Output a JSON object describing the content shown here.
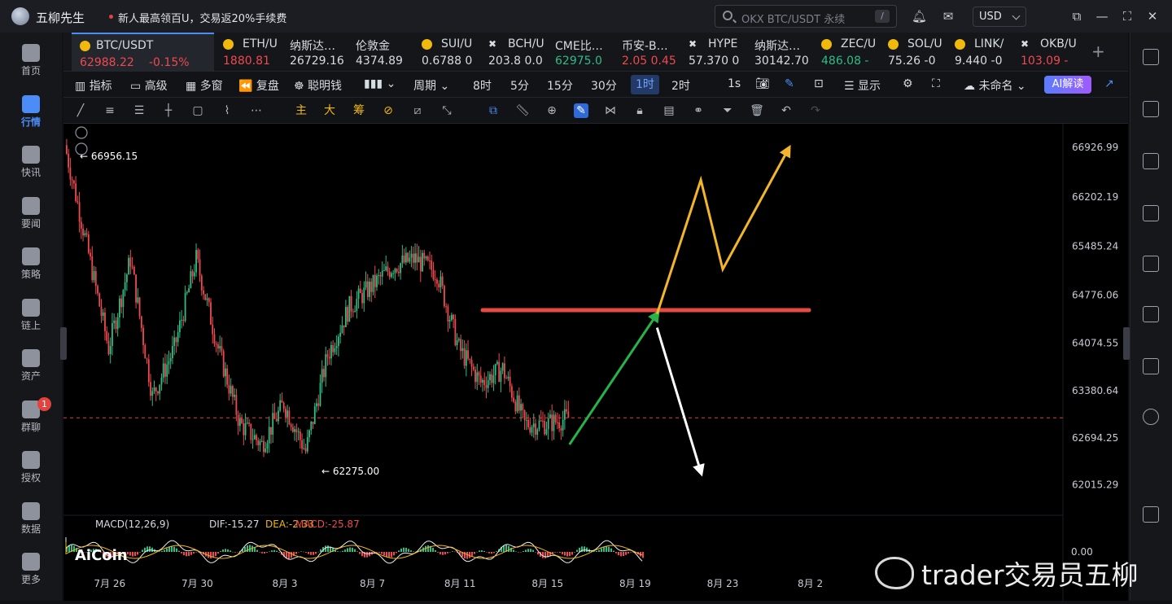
{
  "app": {
    "name": "五柳先生",
    "promo": "新人最高领百U，交易返20%手续费"
  },
  "search": {
    "placeholder": "OKX BTC/USDT 永续",
    "shortcut": "/"
  },
  "currency": "USD",
  "leftnav": [
    {
      "label": "首页",
      "icon": "home-icon"
    },
    {
      "label": "行情",
      "icon": "market-icon",
      "active": true
    },
    {
      "label": "快讯",
      "icon": "flash-news-icon"
    },
    {
      "label": "要闻",
      "icon": "news-icon"
    },
    {
      "label": "策略",
      "icon": "strategy-icon"
    },
    {
      "label": "链上",
      "icon": "onchain-icon"
    },
    {
      "label": "资产",
      "icon": "wallet-icon"
    },
    {
      "label": "群聊",
      "icon": "chat-icon",
      "badge": "1"
    },
    {
      "label": "授权",
      "icon": "auth-icon"
    },
    {
      "label": "数据",
      "icon": "data-icon"
    },
    {
      "label": "更多",
      "icon": "more-icon"
    }
  ],
  "tickers": [
    {
      "name": "BTC/USDT",
      "price": "62988.22",
      "change": "-0.15%",
      "dir": "down",
      "active": true
    },
    {
      "name": "ETH/U",
      "price": "1880.81",
      "dir": "down"
    },
    {
      "name": "纳斯达…",
      "price": "26729.16",
      "dir": "neutral"
    },
    {
      "name": "伦敦金",
      "price": "4374.89",
      "dir": "neutral"
    },
    {
      "name": "SUI/U",
      "price": "0.6788 0",
      "dir": "neutral"
    },
    {
      "name": "BCH/U",
      "price": "203.8 0.0",
      "dir": "neutral"
    },
    {
      "name": "CME比…",
      "price": "62975.0",
      "dir": "up"
    },
    {
      "name": "币安-B…",
      "price": "2.05 0.45",
      "dir": "down"
    },
    {
      "name": "HYPE",
      "price": "57.370 0",
      "dir": "neutral"
    },
    {
      "name": "纳斯达…",
      "price": "30142.70",
      "dir": "neutral"
    },
    {
      "name": "ZEC/U",
      "price": "486.08 -",
      "dir": "up"
    },
    {
      "name": "SOL/U",
      "price": "75.26 -0",
      "dir": "neutral"
    },
    {
      "name": "LINK/",
      "price": "9.440 -0",
      "dir": "neutral"
    },
    {
      "name": "OKB/U",
      "price": "103.09 -",
      "dir": "down"
    }
  ],
  "toolbar": {
    "indicators": "指标",
    "advanced": "高级",
    "multi_window": "多窗",
    "replay": "复盘",
    "smart_money": "聪明钱",
    "period_label": "周期",
    "periods": [
      "8时",
      "5分",
      "15分",
      "30分",
      "1时",
      "2时",
      "1s"
    ],
    "active_period": "1时",
    "display": "显示",
    "unnamed": "未命名",
    "ai": "AI解读"
  },
  "drawtools": {
    "main": "主",
    "big": "大",
    "chip": "筹"
  },
  "chart": {
    "symbol": "BTC/USDT",
    "timeframe": "1时",
    "high_label": "66956.15",
    "low_label": "62275.00",
    "y_ticks": [
      "66926.99",
      "66202.19",
      "65485.24",
      "64776.06",
      "64074.55",
      "63380.64",
      "62694.25",
      "62015.29"
    ],
    "x_ticks": [
      "7月 26",
      "7月 30",
      "8月 3",
      "8月 7",
      "8月 11",
      "8月 15",
      "8月 19",
      "8月 23",
      "8月 2"
    ],
    "current_price": 62988.22,
    "macd": {
      "title": "MACD(12,26,9)",
      "dif": "DIF:-15.27",
      "dea": "DEA:-2.33",
      "macd": "MACD:-25.87",
      "zero": "0.00"
    },
    "brand": "AiCoin"
  },
  "watermark": "trader交易员五柳",
  "chart_data": {
    "type": "candlestick",
    "title": "",
    "xlabel": "",
    "ylabel": "",
    "ylim": [
      61700,
      67150
    ],
    "series": [
      {
        "name": "BTC/USDT close",
        "points": [
          {
            "x": "7月 24",
            "y": 66956
          },
          {
            "x": "7月 25",
            "y": 65500
          },
          {
            "x": "7月 26",
            "y": 64000
          },
          {
            "x": "7月 27",
            "y": 65300
          },
          {
            "x": "7月 28",
            "y": 63300
          },
          {
            "x": "7月 29",
            "y": 64000
          },
          {
            "x": "7月 30",
            "y": 65300
          },
          {
            "x": "7月 31",
            "y": 64000
          },
          {
            "x": "8月 1",
            "y": 62900
          },
          {
            "x": "8月 2",
            "y": 62600
          },
          {
            "x": "8月 3",
            "y": 63200
          },
          {
            "x": "8月 4",
            "y": 62500
          },
          {
            "x": "8月 5",
            "y": 63900
          },
          {
            "x": "8月 6",
            "y": 64600
          },
          {
            "x": "8月 7",
            "y": 64900
          },
          {
            "x": "8月 8",
            "y": 65200
          },
          {
            "x": "8月 9",
            "y": 65300
          },
          {
            "x": "8月 10",
            "y": 65100
          },
          {
            "x": "8月 11",
            "y": 64000
          },
          {
            "x": "8月 12",
            "y": 63500
          },
          {
            "x": "8月 13",
            "y": 63700
          },
          {
            "x": "8月 14",
            "y": 62900
          },
          {
            "x": "8月 15",
            "y": 62900
          },
          {
            "x": "8月 16",
            "y": 62988
          }
        ]
      }
    ],
    "resistance_level": 64555,
    "projections": {
      "green": [
        [
          "8月 16",
          62600
        ],
        [
          "8月 20",
          64500
        ]
      ],
      "yellow": [
        [
          "8月 20",
          64500
        ],
        [
          "8月 22",
          66450
        ],
        [
          "8月 23",
          65150
        ],
        [
          "8月 26",
          66900
        ]
      ],
      "white": [
        [
          "8月 20",
          64300
        ],
        [
          "8月 22",
          62200
        ]
      ]
    }
  }
}
